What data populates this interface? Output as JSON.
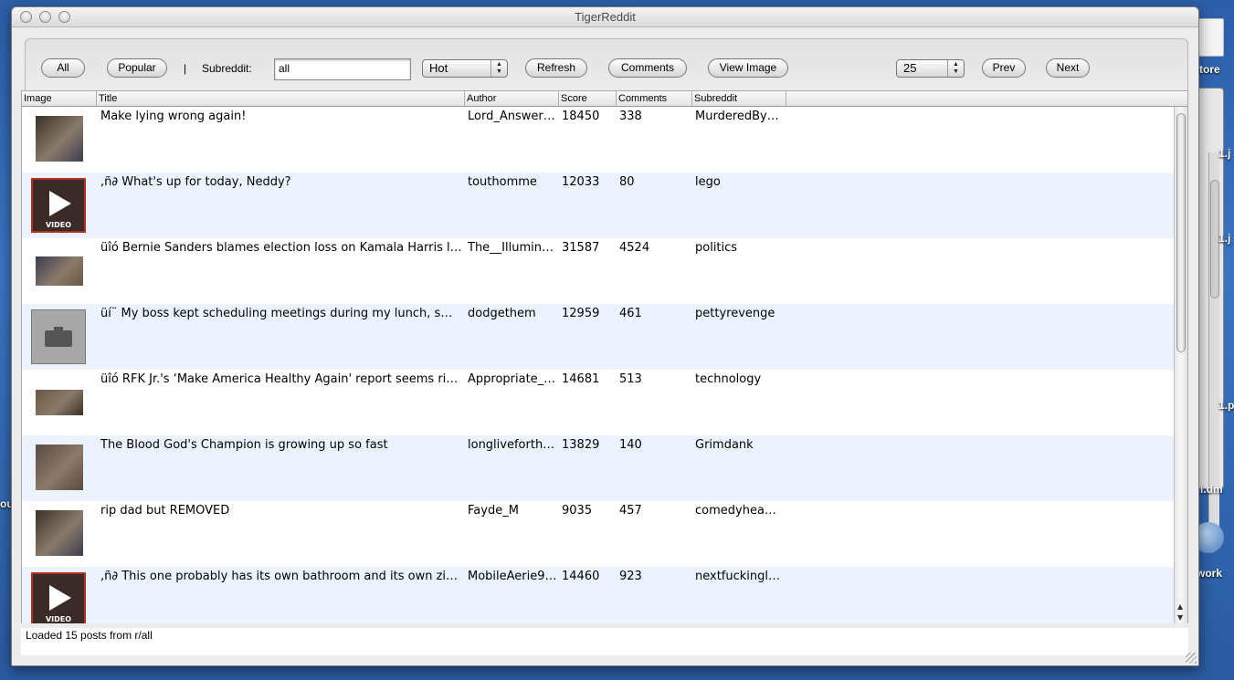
{
  "window": {
    "title": "TigerReddit"
  },
  "toolbar": {
    "all_label": "All",
    "popular_label": "Popular",
    "separator": "|",
    "subreddit_label": "Subreddit:",
    "subreddit_value": "all",
    "sort_value": "Hot",
    "refresh_label": "Refresh",
    "comments_label": "Comments",
    "view_image_label": "View Image",
    "limit_value": "25",
    "prev_label": "Prev",
    "next_label": "Next"
  },
  "table": {
    "columns": [
      "Image",
      "Title",
      "Author",
      "Score",
      "Comments",
      "Subreddit"
    ],
    "rows": [
      {
        "thumb": "photo",
        "title": "Make lying wrong again!",
        "author": "Lord_Answer…",
        "score": "18450",
        "comments": "338",
        "subreddit": "MurderedBy…"
      },
      {
        "thumb": "video",
        "title": ",ñ∂ What's up for today, Neddy?",
        "author": "touthomme",
        "score": "12033",
        "comments": "80",
        "subreddit": "lego"
      },
      {
        "thumb": "photo",
        "title": "üîó Bernie Sanders blames election loss on Kamala Harris l…",
        "author": "The__Illumin…",
        "score": "31587",
        "comments": "4524",
        "subreddit": "politics"
      },
      {
        "thumb": "placeholder",
        "title": "üí¨ My boss kept scheduling meetings during my lunch, s…",
        "author": "dodgethem",
        "score": "12959",
        "comments": "461",
        "subreddit": "pettyrevenge"
      },
      {
        "thumb": "photo",
        "title": "üîó RFK Jr.'s ‘Make America Healthy Again' report seems ri…",
        "author": "Appropriate_…",
        "score": "14681",
        "comments": "513",
        "subreddit": "technology"
      },
      {
        "thumb": "photo",
        "title": "The Blood God's Champion is growing up so fast",
        "author": "longliveforth…",
        "score": "13829",
        "comments": "140",
        "subreddit": "Grimdank"
      },
      {
        "thumb": "photo",
        "title": "rip dad but REMOVED",
        "author": "Fayde_M",
        "score": "9035",
        "comments": "457",
        "subreddit": "comedyheaven"
      },
      {
        "thumb": "video",
        "title": ",ñ∂ This one probably has its own bathroom and its own zip…",
        "author": "MobileAerie9…",
        "score": "14460",
        "comments": "923",
        "subreddit": "nextfuckingl…"
      }
    ],
    "video_badge": "VIDEO"
  },
  "status": {
    "text": "Loaded 15 posts from r/all"
  },
  "desktop": {
    "labels": [
      "tore",
      "1.j",
      "1.j",
      "1.p",
      "l.dm",
      "ou",
      "work"
    ]
  },
  "colors": {
    "alt_row": "#ecf3fe",
    "desktop": "#3a74c2"
  }
}
